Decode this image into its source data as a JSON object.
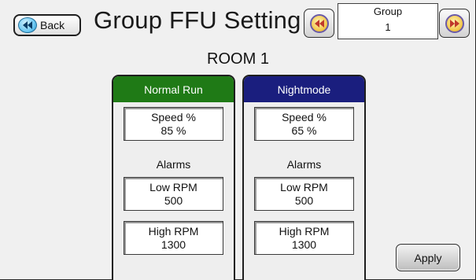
{
  "header": {
    "back_label": "Back",
    "title": "Group FFU Setting",
    "group_label": "Group",
    "group_value": "1"
  },
  "room": {
    "title": "ROOM 1"
  },
  "modes": {
    "normal": {
      "title": "Normal Run",
      "header_color": "#1f7a16",
      "speed_label": "Speed %",
      "speed_value": "85 %",
      "alarms_label": "Alarms",
      "low_rpm_label": "Low RPM",
      "low_rpm_value": "500",
      "high_rpm_label": "High RPM",
      "high_rpm_value": "1300"
    },
    "night": {
      "title": "Nightmode",
      "header_color": "#1a1e7e",
      "speed_label": "Speed %",
      "speed_value": "65 %",
      "alarms_label": "Alarms",
      "low_rpm_label": "Low RPM",
      "low_rpm_value": "500",
      "high_rpm_label": "High RPM",
      "high_rpm_value": "1300"
    }
  },
  "actions": {
    "apply_label": "Apply"
  },
  "icons": {
    "back": "back-arrow-icon",
    "prev": "previous-group-icon",
    "next": "next-group-icon"
  }
}
